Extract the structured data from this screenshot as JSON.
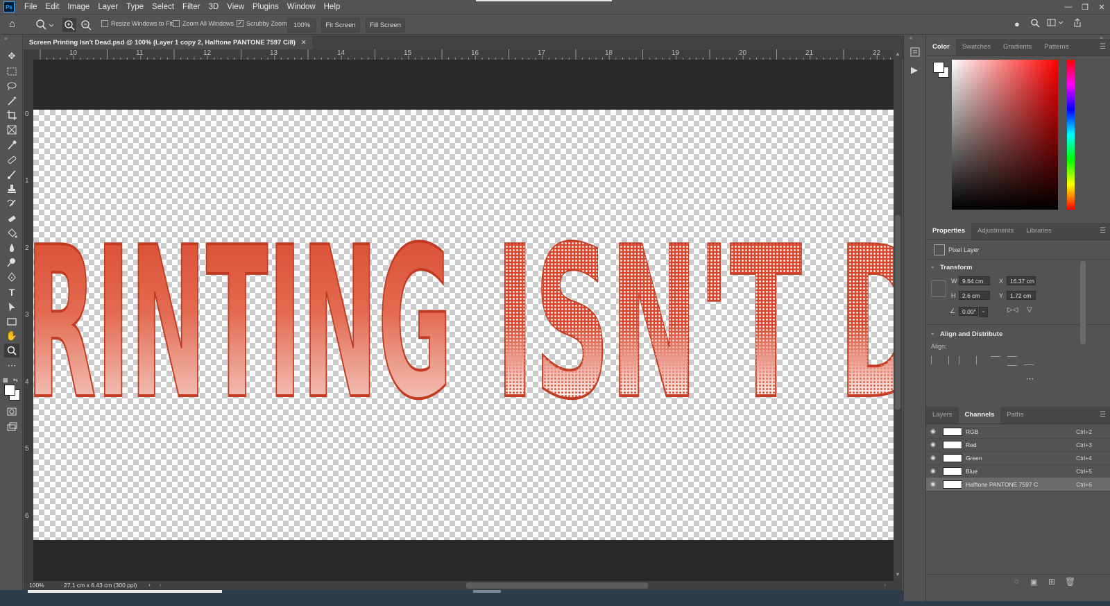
{
  "menu": {
    "logo": "Ps",
    "items": [
      "File",
      "Edit",
      "Image",
      "Layer",
      "Type",
      "Select",
      "Filter",
      "3D",
      "View",
      "Plugins",
      "Window",
      "Help"
    ]
  },
  "options": {
    "resize_windows": "Resize Windows to Fit",
    "zoom_all": "Zoom All Windows",
    "scrubby_zoom": "Scrubby Zoom",
    "zoom_value": "100%",
    "fit_screen": "Fit Screen",
    "fill_screen": "Fill Screen"
  },
  "document": {
    "tab_title": "Screen Printing Isn't Dead.psd @ 100% (Layer 1 copy 2, Halftone PANTONE 7597 C/8)",
    "ruler_h": [
      "10",
      "11",
      "12",
      "13",
      "14",
      "15",
      "16",
      "17",
      "18",
      "19",
      "20",
      "21",
      "22"
    ],
    "ruler_v": [
      "0",
      "1",
      "2",
      "3",
      "4",
      "5",
      "6"
    ],
    "canvas_text_left": "RINTING",
    "canvas_text_right": "ISN'T D"
  },
  "status": {
    "zoom": "100%",
    "doc_size": "27.1 cm x 6.43 cm (300 ppi)"
  },
  "color_panel": {
    "tabs": [
      "Color",
      "Swatches",
      "Gradients",
      "Patterns"
    ],
    "active_tab": "Color"
  },
  "properties_panel": {
    "tabs": [
      "Properties",
      "Adjustments",
      "Libraries"
    ],
    "layer_type": "Pixel Layer",
    "transform_label": "Transform",
    "w_label": "W",
    "w_value": "9.64 cm",
    "h_label": "H",
    "h_value": "2.6 cm",
    "x_label": "X",
    "x_value": "16.37 cm",
    "y_label": "Y",
    "y_value": "1.72 cm",
    "angle_value": "0.00°",
    "align_label": "Align and Distribute",
    "align_sub": "Align:"
  },
  "channels_panel": {
    "tabs": [
      "Layers",
      "Channels",
      "Paths"
    ],
    "rows": [
      {
        "name": "RGB",
        "shortcut": "Ctrl+2"
      },
      {
        "name": "Red",
        "shortcut": "Ctrl+3"
      },
      {
        "name": "Green",
        "shortcut": "Ctrl+4"
      },
      {
        "name": "Blue",
        "shortcut": "Ctrl+5"
      },
      {
        "name": "Halftone PANTONE 7597 C",
        "shortcut": "Ctrl+6"
      }
    ]
  },
  "colors": {
    "ink": "#d8452a",
    "ink_dark": "#c23a22",
    "ui_bg": "#535353"
  }
}
